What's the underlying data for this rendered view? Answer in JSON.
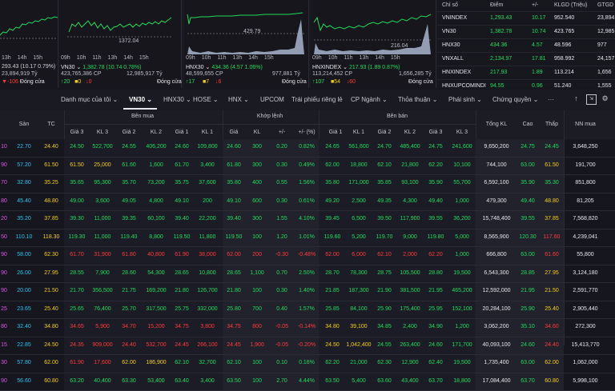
{
  "mini_charts": [
    {
      "name": "vnindex-chart",
      "ticks": [
        "13h",
        "14h",
        "15h"
      ],
      "header_text": "",
      "marker": "",
      "line1": "293.43 (10.17 0.79%)",
      "line1_prefix": "",
      "line2": "23,894,919 Tỷ",
      "line3_up": "",
      "line3_ref": "",
      "line3_dn": "-106",
      "line3_status": "Đóng cửa"
    },
    {
      "name": "vn30-chart",
      "ticks": [
        "09h",
        "10h",
        "11h",
        "13h",
        "14h",
        "15h"
      ],
      "header_text": "VN30",
      "marker": "1372.04",
      "line1": "1,382.78 (10.74 0.78%)",
      "line1_prefix": "VN30",
      "line2": "423,765,386 CP",
      "line2b": "12,985,917 Tỷ",
      "line3_up": "20",
      "line3_ref": "0",
      "line3_dn": "0",
      "line3_status": "Đóng cửa"
    },
    {
      "name": "hnx30-chart",
      "ticks": [
        "09h",
        "10h",
        "11h",
        "13h",
        "14h",
        "15h"
      ],
      "header_text": "HNX30",
      "marker": "429.79",
      "line1": "434.36 (4.57 1.06%)",
      "line1_prefix": "HNX30",
      "line2": "48,599,655 CP",
      "line2b": "977,881 Tỷ",
      "line3_up": "17",
      "line3_ref": "7",
      "line3_dn": "6",
      "line3_status": "Đóng cửa"
    },
    {
      "name": "hnxindex-chart",
      "ticks": [
        "09h",
        "10h",
        "11h",
        "13h",
        "14h",
        "15h"
      ],
      "header_text": "HNXINDEX",
      "marker": "216.04",
      "line1": "217.93 (1.89 0.87%)",
      "line1_prefix": "HNXINDEX",
      "line2": "113,214,452 CP",
      "line2b": "1,656,285 Tỷ",
      "line3_up": "107",
      "line3_ref": "54",
      "line3_dn": "60",
      "line3_status": "Đóng cửa"
    }
  ],
  "index_table": {
    "headers": [
      "Chỉ số",
      "Điểm",
      "+/-",
      "KLGD (Triệu)",
      "GTGD ("
    ],
    "rows": [
      {
        "name": "VNINDEX",
        "point": "1,293.43",
        "chg": "10.17",
        "vol": "952.540",
        "val": "23,894"
      },
      {
        "name": "VN30",
        "point": "1,382.78",
        "chg": "10.74",
        "vol": "423.765",
        "val": "12,985"
      },
      {
        "name": "HNX30",
        "point": "434.36",
        "chg": "4.57",
        "vol": "48.596",
        "val": "977"
      },
      {
        "name": "VNXALL",
        "point": "2,134.97",
        "chg": "17.81",
        "vol": "958.992",
        "val": "24,157"
      },
      {
        "name": "HNXINDEX",
        "point": "217.93",
        "chg": "1.89",
        "vol": "113.214",
        "val": "1,656"
      },
      {
        "name": "HNXUPCOMINDI",
        "point": "94.55",
        "chg": "0.96",
        "vol": "51.240",
        "val": "1,555"
      }
    ]
  },
  "tabs": {
    "items": [
      "Danh mục của tôi",
      "VN30",
      "HNX30",
      "HOSE",
      "HNX",
      "UPCOM",
      "Trái phiếu riêng lẻ",
      "CP Ngành",
      "Thỏa thuận",
      "Phái sinh",
      "Chứng quyền",
      "···"
    ],
    "active": "VN30"
  },
  "table_headers": {
    "san": "Sàn",
    "tc": "TC",
    "ben_mua": "Bên mua",
    "khop_lenh": "Khớp lệnh",
    "ben_ban": "Bên bán",
    "gia3": "Giá 3",
    "kl3": "KL 3",
    "gia2": "Giá 2",
    "kl2": "KL 2",
    "gia1": "Giá 1",
    "kl1": "KL 1",
    "gia": "Giá",
    "kl": "KL",
    "pm": "+/-",
    "pct": "+/- (%)",
    "sgia1": "Giá 1",
    "skl1": "KL 1",
    "sgia2": "Giá 2",
    "skl2": "KL 2",
    "sgia3": "Giá 3",
    "skl3": "KL 3",
    "tongkl": "Tổng KL",
    "cao": "Cao",
    "thap": "Thấp",
    "nnmua": "NN mua"
  },
  "rows": [
    {
      "tran": "10",
      "san": "22.70",
      "tc": "24.40",
      "b3": "24.50",
      "bk3": "522,700",
      "b2": "24.55",
      "bk2": "406,200",
      "b1": "24.60",
      "bk1": "109,800",
      "p": "24.60",
      "v": "300",
      "d": "0.20",
      "dp": "0.82%",
      "s1": "24.65",
      "sk1": "561,600",
      "s2": "24.70",
      "sk2": "485,400",
      "s3": "24.75",
      "sk3": "241,600",
      "tot": "9,650,200",
      "hi": "24.75",
      "lo": "24.45",
      "nn": "3,648,250",
      "c": [
        "up",
        "up",
        "up",
        "up",
        "up",
        "up",
        "up",
        "up",
        "up",
        "up",
        "up",
        "up",
        "up",
        "up",
        "up",
        "up",
        "up"
      ]
    },
    {
      "tran": "90",
      "san": "57.20",
      "tc": "61.50",
      "b3": "61.50",
      "bk3": "25,000",
      "b2": "61.60",
      "bk2": "1,600",
      "b1": "61.70",
      "bk1": "3,400",
      "p": "61.80",
      "v": "300",
      "d": "0.30",
      "dp": "0.49%",
      "s1": "62.00",
      "sk1": "18,800",
      "s2": "62.10",
      "sk2": "21,800",
      "s3": "62.20",
      "sk3": "10,100",
      "tot": "744,100",
      "hi": "63.00",
      "lo": "61.50",
      "nn": "191,700",
      "c": [
        "ref",
        "ref",
        "up",
        "up",
        "up",
        "up",
        "up",
        "up",
        "up",
        "up",
        "up",
        "up",
        "up",
        "up",
        "up",
        "up",
        "ref"
      ]
    },
    {
      "tran": "70",
      "san": "32.80",
      "tc": "35.25",
      "b3": "35.65",
      "bk3": "95,300",
      "b2": "35.70",
      "bk2": "73,200",
      "b1": "35.75",
      "bk1": "37,600",
      "p": "35.80",
      "v": "400",
      "d": "0.55",
      "dp": "1.56%",
      "s1": "35.80",
      "sk1": "171,000",
      "s2": "35.85",
      "sk2": "93,100",
      "s3": "35.90",
      "sk3": "55,700",
      "tot": "6,592,100",
      "hi": "35.90",
      "lo": "35.30",
      "nn": "851,800",
      "c": [
        "up",
        "up",
        "up",
        "up",
        "up",
        "up",
        "up",
        "up",
        "up",
        "up",
        "up",
        "up",
        "up",
        "up",
        "up",
        "up",
        "up"
      ]
    },
    {
      "tran": "80",
      "san": "45.40",
      "tc": "48.80",
      "b3": "49.00",
      "bk3": "3,600",
      "b2": "49.05",
      "bk2": "4,800",
      "b1": "49.10",
      "bk1": "200",
      "p": "49.10",
      "v": "600",
      "d": "0.30",
      "dp": "0.61%",
      "s1": "49.20",
      "sk1": "2,500",
      "s2": "49.35",
      "sk2": "4,300",
      "s3": "49.40",
      "sk3": "1,000",
      "tot": "479,300",
      "hi": "49.40",
      "lo": "48.80",
      "nn": "81,205",
      "c": [
        "up",
        "up",
        "up",
        "up",
        "up",
        "up",
        "up",
        "up",
        "up",
        "up",
        "up",
        "up",
        "up",
        "up",
        "up",
        "up",
        "ref"
      ]
    },
    {
      "tran": "20",
      "san": "35.20",
      "tc": "37.85",
      "b3": "39.30",
      "bk3": "11,000",
      "b2": "39.35",
      "bk2": "60,100",
      "b1": "39.40",
      "bk1": "22,200",
      "p": "39.40",
      "v": "300",
      "d": "1.55",
      "dp": "4.10%",
      "s1": "39.45",
      "sk1": "6,500",
      "s2": "39.50",
      "sk2": "117,900",
      "s3": "39.55",
      "sk3": "36,200",
      "tot": "15,748,400",
      "hi": "39.55",
      "lo": "37.85",
      "nn": "7,568,820",
      "c": [
        "up",
        "up",
        "up",
        "up",
        "up",
        "up",
        "up",
        "up",
        "up",
        "up",
        "up",
        "up",
        "up",
        "up",
        "up",
        "up",
        "ref"
      ]
    },
    {
      "tran": "50",
      "san": "110.10",
      "tc": "118.30",
      "b3": "119.30",
      "bk3": "11,000",
      "b2": "119.40",
      "bk2": "8,800",
      "b1": "119.50",
      "bk1": "11,800",
      "p": "119.50",
      "v": "100",
      "d": "1.20",
      "dp": "1.01%",
      "s1": "119.60",
      "sk1": "5,200",
      "s2": "119.70",
      "sk2": "9,000",
      "s3": "119.80",
      "sk3": "5,000",
      "tot": "8,565,900",
      "hi": "120.30",
      "lo": "117.60",
      "nn": "4,239,041",
      "c": [
        "up",
        "up",
        "up",
        "up",
        "up",
        "up",
        "up",
        "up",
        "up",
        "up",
        "up",
        "up",
        "up",
        "up",
        "up",
        "up",
        "dn"
      ]
    },
    {
      "tran": "90",
      "san": "58.00",
      "tc": "62.30",
      "b3": "61.70",
      "bk3": "31,900",
      "b2": "61.80",
      "bk2": "40,800",
      "b1": "61.90",
      "bk1": "38,000",
      "p": "62.00",
      "v": "200",
      "d": "-0.30",
      "dp": "-0.48%",
      "s1": "62.00",
      "sk1": "6,000",
      "s2": "62.10",
      "sk2": "2,000",
      "s3": "62.20",
      "sk3": "1,000",
      "tot": "666,800",
      "hi": "63.00",
      "lo": "61.60",
      "nn": "55,800",
      "c": [
        "dn",
        "dn",
        "dn",
        "dn",
        "dn",
        "dn",
        "dn",
        "dn",
        "dn",
        "dn",
        "dn",
        "dn",
        "dn",
        "dn",
        "dn",
        "up",
        "dn"
      ]
    },
    {
      "tran": "90",
      "san": "26.00",
      "tc": "27.95",
      "b3": "28.55",
      "bk3": "7,900",
      "b2": "28.60",
      "bk2": "54,300",
      "b1": "28.65",
      "bk1": "10,800",
      "p": "28.65",
      "v": "1,100",
      "d": "0.70",
      "dp": "2.50%",
      "s1": "28.70",
      "sk1": "78,300",
      "s2": "28.75",
      "sk2": "105,500",
      "s3": "28.80",
      "sk3": "19,500",
      "tot": "6,543,300",
      "hi": "28.85",
      "lo": "27.95",
      "nn": "3,124,180",
      "c": [
        "up",
        "up",
        "up",
        "up",
        "up",
        "up",
        "up",
        "up",
        "up",
        "up",
        "up",
        "up",
        "up",
        "up",
        "up",
        "up",
        "ref"
      ]
    },
    {
      "tran": "90",
      "san": "20.00",
      "tc": "21.50",
      "b3": "21.70",
      "bk3": "356,500",
      "b2": "21.75",
      "bk2": "169,200",
      "b1": "21.80",
      "bk1": "126,700",
      "p": "21.80",
      "v": "100",
      "d": "0.30",
      "dp": "1.40%",
      "s1": "21.85",
      "sk1": "187,300",
      "s2": "21.90",
      "sk2": "381,500",
      "s3": "21.95",
      "sk3": "465,200",
      "tot": "12,592,000",
      "hi": "21.95",
      "lo": "21.50",
      "nn": "2,591,770",
      "c": [
        "up",
        "up",
        "up",
        "up",
        "up",
        "up",
        "up",
        "up",
        "up",
        "up",
        "up",
        "up",
        "up",
        "up",
        "up",
        "up",
        "ref"
      ]
    },
    {
      "tran": "25",
      "san": "23.65",
      "tc": "25.40",
      "b3": "25.65",
      "bk3": "76,400",
      "b2": "25.70",
      "bk2": "317,500",
      "b1": "25.75",
      "bk1": "332,000",
      "p": "25.80",
      "v": "700",
      "d": "0.40",
      "dp": "1.57%",
      "s1": "25.85",
      "sk1": "84,100",
      "s2": "25.90",
      "sk2": "175,400",
      "s3": "25.95",
      "sk3": "152,100",
      "tot": "20,284,100",
      "hi": "25.90",
      "lo": "25.40",
      "nn": "2,905,440",
      "c": [
        "up",
        "up",
        "up",
        "up",
        "up",
        "up",
        "up",
        "up",
        "up",
        "up",
        "up",
        "up",
        "up",
        "up",
        "up",
        "up",
        "ref"
      ]
    },
    {
      "tran": "80",
      "san": "32.40",
      "tc": "34.80",
      "b3": "34.65",
      "bk3": "5,900",
      "b2": "34.70",
      "bk2": "15,200",
      "b1": "34.75",
      "bk1": "3,800",
      "p": "34.75",
      "v": "800",
      "d": "-0.05",
      "dp": "-0.14%",
      "s1": "34.80",
      "sk1": "39,100",
      "s2": "34.85",
      "sk2": "2,400",
      "s3": "34.90",
      "sk3": "1,200",
      "tot": "3,062,200",
      "hi": "35.10",
      "lo": "34.60",
      "nn": "272,300",
      "c": [
        "dn",
        "dn",
        "dn",
        "dn",
        "dn",
        "dn",
        "dn",
        "dn",
        "dn",
        "dn",
        "ref",
        "ref",
        "up",
        "up",
        "up",
        "up",
        "dn"
      ]
    },
    {
      "tran": "15",
      "san": "22.85",
      "tc": "24.50",
      "b3": "24.35",
      "bk3": "909,000",
      "b2": "24.40",
      "bk2": "532,700",
      "b1": "24.45",
      "bk1": "266,100",
      "p": "24.45",
      "v": "1,900",
      "d": "-0.05",
      "dp": "-0.20%",
      "s1": "24.50",
      "sk1": "1,042,400",
      "s2": "24.55",
      "sk2": "263,400",
      "s3": "24.60",
      "sk3": "171,700",
      "tot": "40,093,100",
      "hi": "24.60",
      "lo": "24.40",
      "nn": "15,413,770",
      "c": [
        "dn",
        "dn",
        "dn",
        "dn",
        "dn",
        "dn",
        "dn",
        "dn",
        "dn",
        "dn",
        "ref",
        "ref",
        "up",
        "up",
        "up",
        "up",
        "dn"
      ]
    },
    {
      "tran": "30",
      "san": "57.80",
      "tc": "62.00",
      "b3": "61.90",
      "bk3": "17,600",
      "b2": "62.00",
      "bk2": "186,900",
      "b1": "62.10",
      "bk1": "32,700",
      "p": "62.10",
      "v": "100",
      "d": "0.10",
      "dp": "0.16%",
      "s1": "62.20",
      "sk1": "21,000",
      "s2": "62.30",
      "sk2": "12,900",
      "s3": "62.40",
      "sk3": "19,500",
      "tot": "1,735,400",
      "hi": "63.00",
      "lo": "62.00",
      "nn": "1,062,000",
      "c": [
        "dn",
        "dn",
        "ref",
        "ref",
        "up",
        "up",
        "up",
        "up",
        "up",
        "up",
        "up",
        "up",
        "up",
        "up",
        "up",
        "up",
        "ref"
      ]
    },
    {
      "tran": "90",
      "san": "56.60",
      "tc": "60.80",
      "b3": "63.20",
      "bk3": "40,400",
      "b2": "63.30",
      "bk2": "53,400",
      "b1": "63.40",
      "bk1": "3,400",
      "p": "63.50",
      "v": "100",
      "d": "2.70",
      "dp": "4.44%",
      "s1": "63.50",
      "sk1": "5,400",
      "s2": "63.60",
      "sk2": "43,400",
      "s3": "63.70",
      "sk3": "18,800",
      "tot": "17,084,400",
      "hi": "63.70",
      "lo": "60.80",
      "nn": "5,998,100",
      "c": [
        "up",
        "up",
        "up",
        "up",
        "up",
        "up",
        "up",
        "up",
        "up",
        "up",
        "up",
        "up",
        "up",
        "up",
        "up",
        "up",
        "ref"
      ]
    }
  ],
  "colors": {
    "up": "#1fdd5b",
    "down": "#ff3b3b",
    "ref": "#f5d113",
    "ceil": "#e055e8",
    "floor": "#2bc4f0",
    "bg": "#16161e"
  }
}
